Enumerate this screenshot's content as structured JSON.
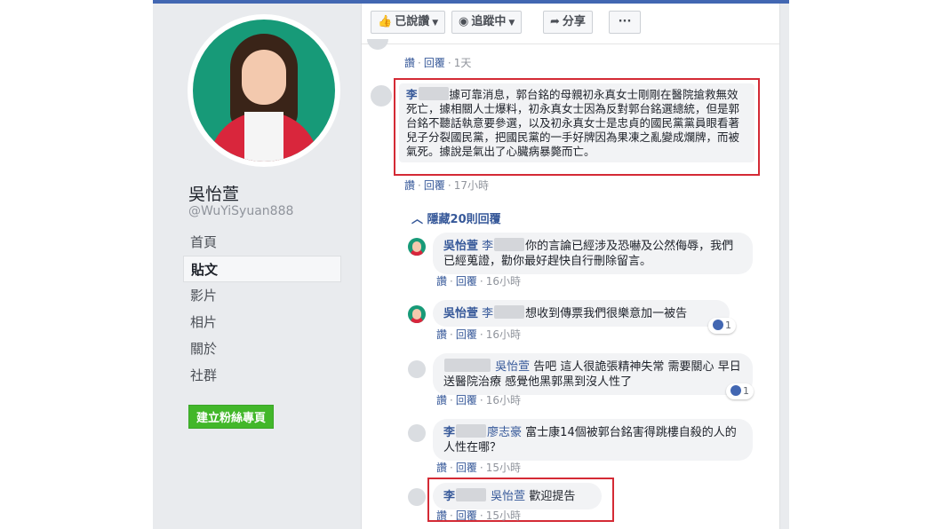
{
  "sidebar": {
    "page_name": "吳怡萱",
    "handle": "@WuYiSyuan888",
    "nav": [
      "首頁",
      "貼文",
      "影片",
      "相片",
      "關於",
      "社群"
    ],
    "active_index": 1,
    "create_button": "建立粉絲專頁"
  },
  "actionbar": {
    "liked": {
      "icon": "thumbs-up-icon",
      "label": "已說讚"
    },
    "following": {
      "icon": "rss-icon",
      "label": "追蹤中"
    },
    "share": {
      "icon": "share-arrow-icon",
      "label": "分享"
    },
    "more": "···"
  },
  "comments": {
    "top_meta": {
      "like": "讚",
      "reply": "回覆",
      "time": "1天"
    },
    "c1": {
      "name": "李",
      "text": "據可靠消息，郭台銘的母親初永真女士剛剛在醫院搶救無效死亡，據相關人士爆料，初永真女士因為反對郭台銘選總統，但是郭台銘不聽話執意要參選，以及初永真女士是忠貞的國民黨黨員眼看著兒子分裂國民黨，把國民黨的一手好牌因為果凍之亂變成爛牌，而被氣死。據說是氣出了心臟病暴斃而亡。",
      "meta": {
        "like": "讚",
        "reply": "回覆",
        "time": "17小時"
      }
    },
    "hide_replies": "隱藏20則回覆",
    "r1": {
      "name": "吳怡萱",
      "mention": "李",
      "text": "你的言論已經涉及恐嚇及公然侮辱，我們已經蒐證，勸你最好趕快自行刪除留言。",
      "meta": {
        "like": "讚",
        "reply": "回覆",
        "time": "16小時"
      }
    },
    "r2": {
      "name": "吳怡萱",
      "mention": "李",
      "text": "想收到傳票我們很樂意加一被告",
      "meta": {
        "like": "讚",
        "reply": "回覆",
        "time": "16小時"
      },
      "reactions": "1"
    },
    "r3": {
      "mention": "吳怡萱",
      "text": "告吧  這人很詭張精神失常 需要關心 早日送醫院治療 感覺他黑郭黑到沒人性了",
      "meta": {
        "like": "讚",
        "reply": "回覆",
        "time": "16小時"
      },
      "reactions": "1"
    },
    "r4": {
      "name": "李",
      "mention": "廖志豪",
      "text": "富士康14個被郭台銘害得跳樓自殺的人的人性在哪？",
      "meta": {
        "like": "讚",
        "reply": "回覆",
        "time": "15小時"
      }
    },
    "r5": {
      "name": "李",
      "mention": "吳怡萱",
      "text": "歡迎提告",
      "meta": {
        "like": "讚",
        "reply": "回覆",
        "time": "15小時"
      }
    }
  },
  "colors": {
    "accent": "#4267b2",
    "highlight_box": "#d42a35",
    "link": "#365899",
    "cta": "#42b72a"
  }
}
